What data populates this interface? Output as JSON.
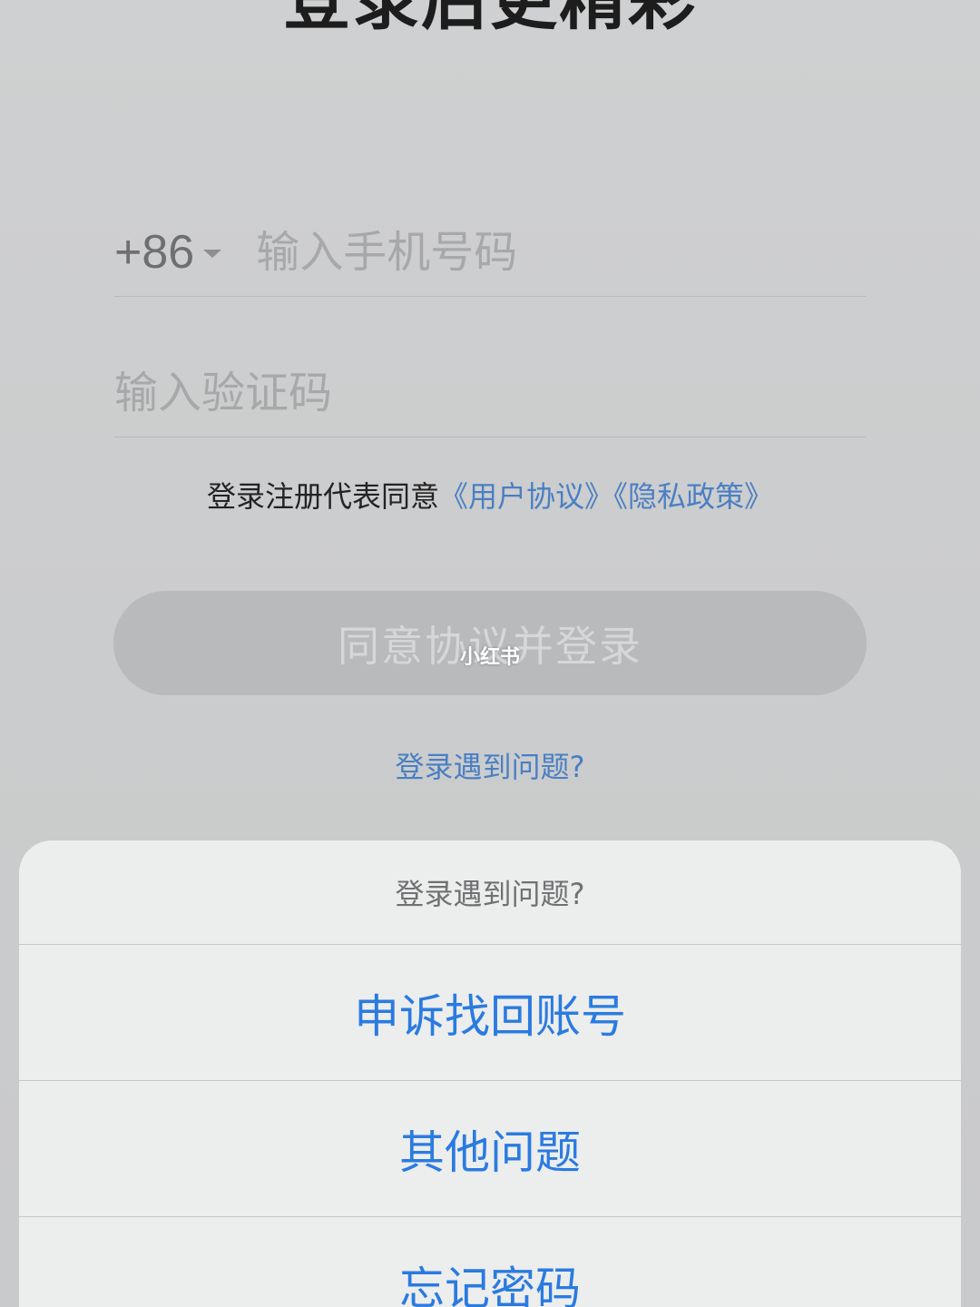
{
  "page": {
    "title": "登录后更精彩"
  },
  "phone": {
    "country_code": "+86",
    "placeholder": "输入手机号码",
    "value": ""
  },
  "code": {
    "placeholder": "输入验证码",
    "value": ""
  },
  "agreement": {
    "prefix": "登录注册代表同意",
    "user_agreement": "《用户协议》",
    "privacy_policy": "《隐私政策》"
  },
  "login_button": {
    "label": "同意协议并登录"
  },
  "watermark": "小红书",
  "help_link": "登录遇到问题?",
  "action_sheet": {
    "title": "登录遇到问题?",
    "items": [
      {
        "label": "申诉找回账号"
      },
      {
        "label": "其他问题"
      },
      {
        "label": "忘记密码"
      }
    ]
  },
  "colors": {
    "link": "#4a7fc3",
    "action": "#2a7be0",
    "button_disabled": "#b9babb"
  }
}
